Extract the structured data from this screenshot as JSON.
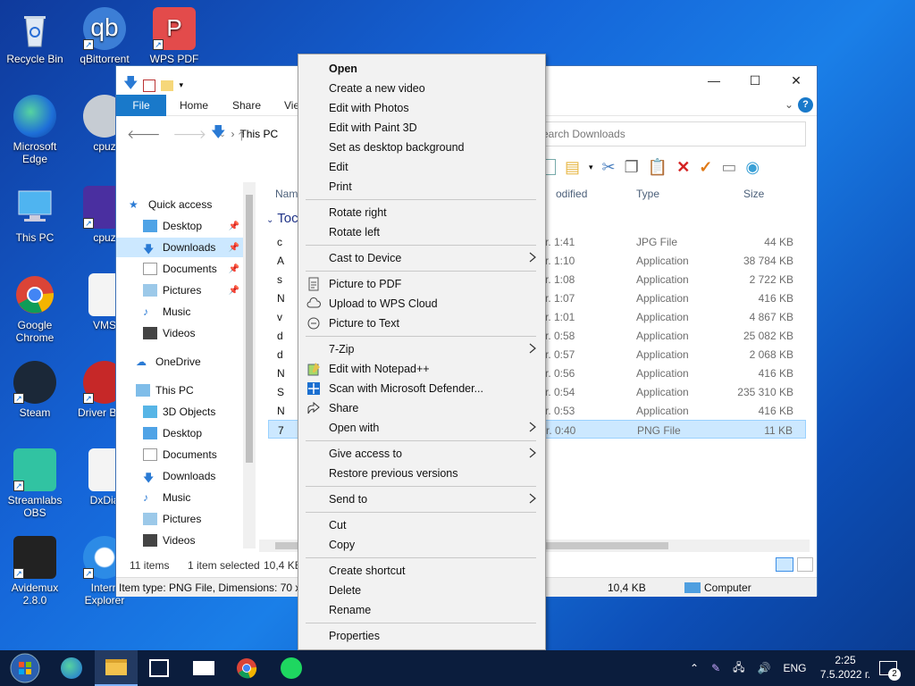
{
  "desktop": {
    "icons": [
      {
        "label": "Recycle Bin"
      },
      {
        "label": "qBittorrent"
      },
      {
        "label": "WPS PDF"
      },
      {
        "label": "Microsoft Edge"
      },
      {
        "label": "cpuz"
      },
      {
        "label": "This PC"
      },
      {
        "label": "cpuz"
      },
      {
        "label": "Google Chrome"
      },
      {
        "label": "VMS"
      },
      {
        "label": "Steam"
      },
      {
        "label": "Driver Bo 9"
      },
      {
        "label": "Streamlabs OBS"
      },
      {
        "label": "DxDia"
      },
      {
        "label": "Avidemux 2.8.0"
      },
      {
        "label": "Intern Explorer"
      }
    ]
  },
  "explorer": {
    "tabs": {
      "file": "File",
      "home": "Home",
      "share": "Share",
      "view": "Vie"
    },
    "breadcrumb": "This PC",
    "search_placeholder": "earch Downloads",
    "columns": {
      "name": "Nam",
      "modified": "odified",
      "type": "Type",
      "size": "Size"
    },
    "group": "Toc",
    "nav": {
      "quick_access": "Quick access",
      "items": [
        {
          "label": "Desktop",
          "pinned": true
        },
        {
          "label": "Downloads",
          "pinned": true
        },
        {
          "label": "Documents",
          "pinned": true
        },
        {
          "label": "Pictures",
          "pinned": true
        },
        {
          "label": "Music",
          "pinned": false
        },
        {
          "label": "Videos",
          "pinned": false
        }
      ],
      "onedrive": "OneDrive",
      "this_pc": "This PC",
      "pc_items": [
        "3D Objects",
        "Desktop",
        "Documents",
        "Downloads",
        "Music",
        "Pictures",
        "Videos"
      ]
    },
    "rows": [
      {
        "name": "c",
        "time": "r. 1:41",
        "type": "JPG File",
        "size": "44 KB"
      },
      {
        "name": "A",
        "time": "r. 1:10",
        "type": "Application",
        "size": "38 784 KB"
      },
      {
        "name": "s",
        "time": "r. 1:08",
        "type": "Application",
        "size": "2 722 KB"
      },
      {
        "name": "N",
        "time": "r. 1:07",
        "type": "Application",
        "size": "416 KB"
      },
      {
        "name": "v",
        "time": "r. 1:01",
        "type": "Application",
        "size": "4 867 KB"
      },
      {
        "name": "d",
        "time": "r. 0:58",
        "type": "Application",
        "size": "25 082 KB"
      },
      {
        "name": "d",
        "time": "r. 0:57",
        "type": "Application",
        "size": "2 068 KB"
      },
      {
        "name": "N",
        "time": "r. 0:56",
        "type": "Application",
        "size": "416 KB"
      },
      {
        "name": "S",
        "time": "r. 0:54",
        "type": "Application",
        "size": "235 310 KB"
      },
      {
        "name": "N",
        "time": "r. 0:53",
        "type": "Application",
        "size": "416 KB"
      },
      {
        "name": "7",
        "time": "r. 0:40",
        "type": "PNG File",
        "size": "11 KB"
      }
    ],
    "status": {
      "count": "11 items",
      "selected": "1 item selected",
      "size": "10,4 KB"
    },
    "details": {
      "type": "Item type: PNG File, Dimensions: 70 x 7",
      "size": "10,4 KB",
      "location": "Computer"
    }
  },
  "context_menu": {
    "items": [
      {
        "label": "Open"
      },
      {
        "label": "Create a new video"
      },
      {
        "label": "Edit with Photos"
      },
      {
        "label": "Edit with Paint 3D"
      },
      {
        "label": "Set as desktop background"
      },
      {
        "label": "Edit"
      },
      {
        "label": "Print"
      },
      {
        "label": "Rotate right"
      },
      {
        "label": "Rotate left"
      },
      {
        "label": "Cast to Device"
      },
      {
        "label": "Picture to PDF"
      },
      {
        "label": "Upload to WPS Cloud"
      },
      {
        "label": "Picture to Text"
      },
      {
        "label": "7-Zip"
      },
      {
        "label": "Edit with Notepad++"
      },
      {
        "label": "Scan with Microsoft Defender..."
      },
      {
        "label": "Share"
      },
      {
        "label": "Open with"
      },
      {
        "label": "Give access to"
      },
      {
        "label": "Restore previous versions"
      },
      {
        "label": "Send to"
      },
      {
        "label": "Cut"
      },
      {
        "label": "Copy"
      },
      {
        "label": "Create shortcut"
      },
      {
        "label": "Delete"
      },
      {
        "label": "Rename"
      },
      {
        "label": "Properties"
      }
    ]
  },
  "taskbar": {
    "language": "ENG",
    "time": "2:25",
    "date": "7.5.2022 г.",
    "notifications": "2"
  }
}
